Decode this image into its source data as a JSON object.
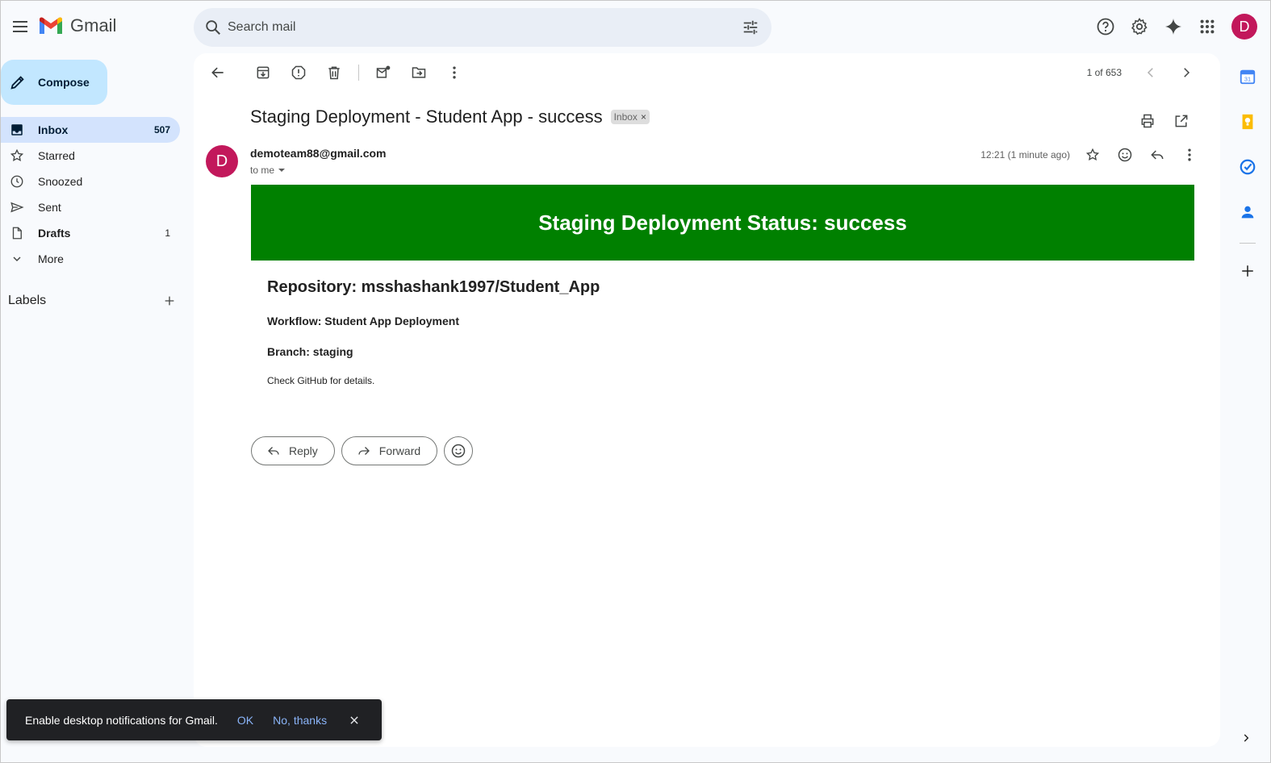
{
  "app": {
    "name": "Gmail"
  },
  "header": {
    "search_placeholder": "Search mail",
    "avatar_letter": "D"
  },
  "sidebar": {
    "compose_label": "Compose",
    "items": [
      {
        "label": "Inbox",
        "count": "507",
        "icon": "inbox-icon"
      },
      {
        "label": "Starred",
        "count": "",
        "icon": "star-icon"
      },
      {
        "label": "Snoozed",
        "count": "",
        "icon": "clock-icon"
      },
      {
        "label": "Sent",
        "count": "",
        "icon": "send-icon"
      },
      {
        "label": "Drafts",
        "count": "1",
        "icon": "draft-icon"
      },
      {
        "label": "More",
        "count": "",
        "icon": "chevron-down-icon"
      }
    ],
    "labels_title": "Labels"
  },
  "toolbar": {
    "pager": "1 of 653"
  },
  "email": {
    "subject": "Staging Deployment - Student App - success",
    "chip": "Inbox",
    "chip_close": "×",
    "sender_letter": "D",
    "sender": "demoteam88@gmail.com",
    "to": "to me",
    "time": "12:21 (1 minute ago)",
    "body": {
      "banner": "Staging Deployment Status: success",
      "repository": "Repository: msshashank1997/Student_App",
      "workflow": "Workflow: Student App Deployment",
      "branch": "Branch: staging",
      "details": "Check GitHub for details."
    },
    "reply_label": "Reply",
    "forward_label": "Forward"
  },
  "toast": {
    "message": "Enable desktop notifications for Gmail.",
    "ok": "OK",
    "no": "No, thanks"
  },
  "colors": {
    "banner_green": "#008000",
    "avatar": "#c2185b",
    "compose_bg": "#c2e7ff",
    "inbox_active": "#d3e3fd",
    "toast_link": "#8ab4f8"
  }
}
